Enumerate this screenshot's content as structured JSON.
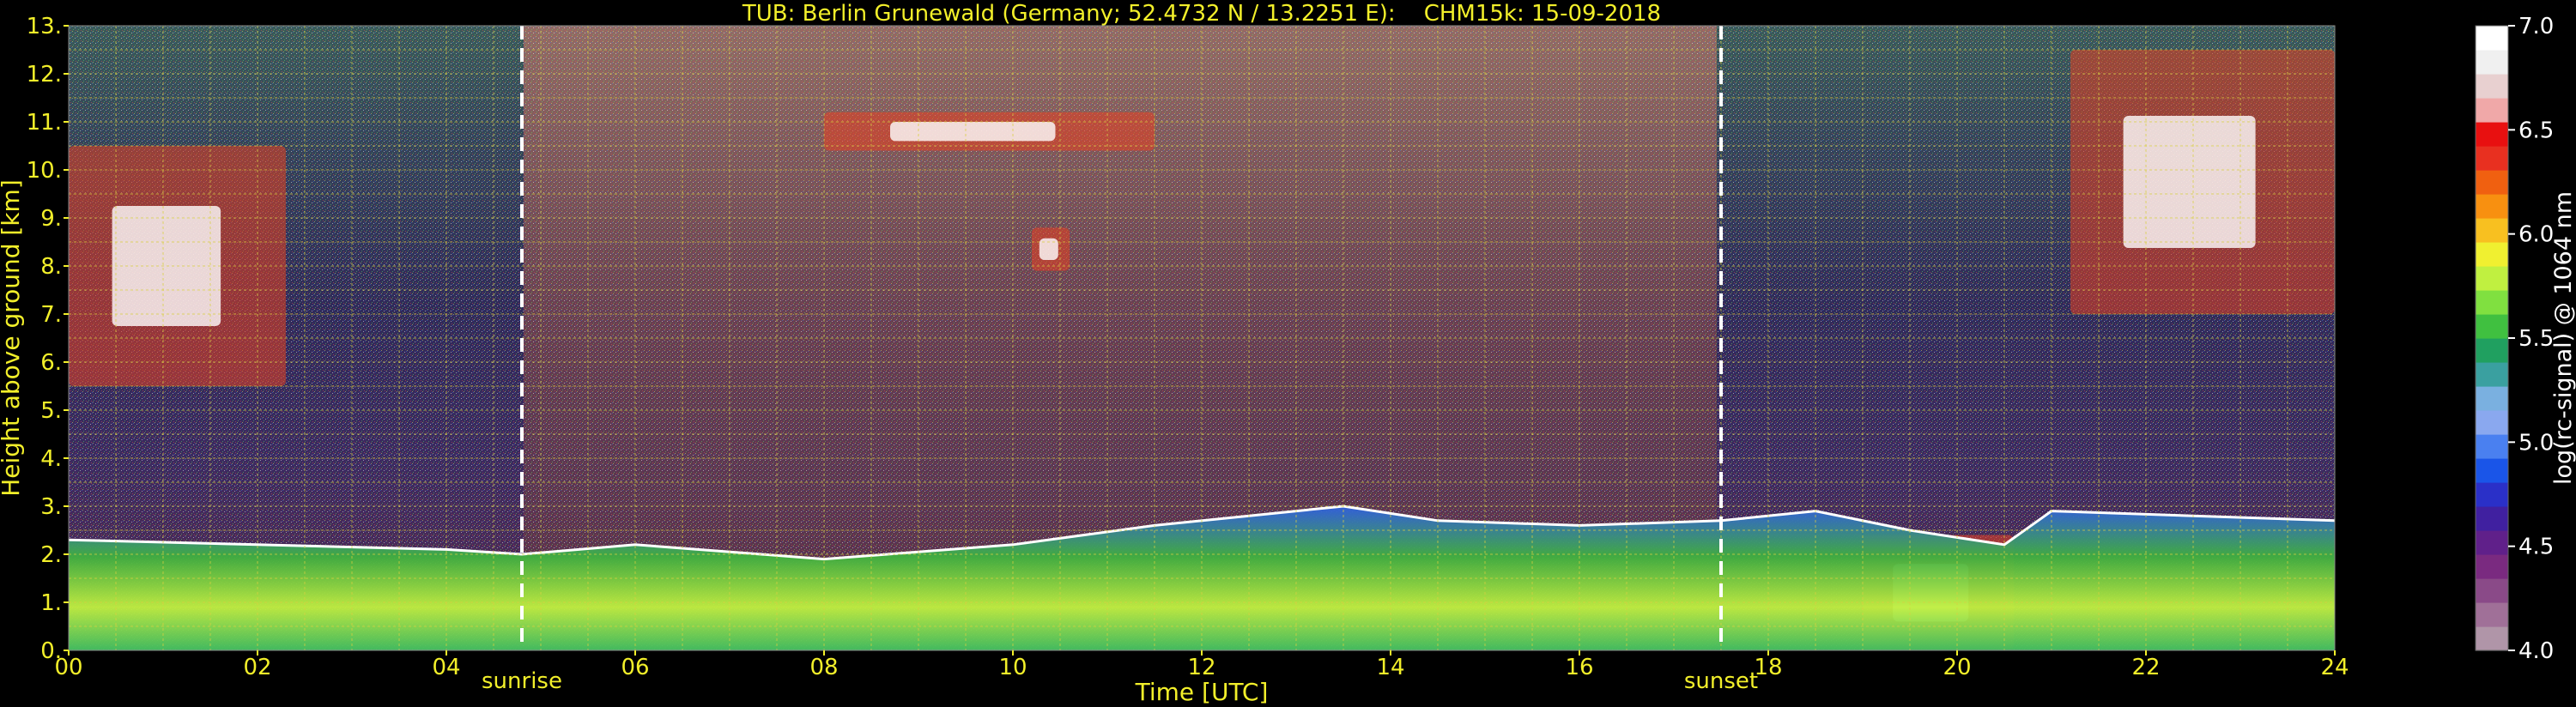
{
  "chart_data": {
    "type": "heatmap",
    "title": "TUB: Berlin Grunewald (Germany; 52.4732 N / 13.2251 E):    CHM15k: 15-09-2018",
    "xlabel": "Time [UTC]",
    "ylabel": "Height above ground [km]",
    "xlim": [
      0,
      24
    ],
    "ylim": [
      0,
      13
    ],
    "x_ticks": [
      "00",
      "02",
      "04",
      "06",
      "08",
      "10",
      "12",
      "14",
      "16",
      "18",
      "20",
      "22",
      "24"
    ],
    "y_ticks": [
      "0.",
      "1.",
      "2.",
      "3.",
      "4.",
      "5.",
      "6.",
      "7.",
      "8.",
      "9.",
      "10.",
      "11.",
      "12.",
      "13."
    ],
    "grid": true,
    "colorbar": {
      "label": "log(rc-signal) @ 1064 nm",
      "range": [
        4.0,
        7.0
      ],
      "ticks": [
        "4.0",
        "4.5",
        "5.0",
        "5.5",
        "6.0",
        "6.5",
        "7.0"
      ],
      "colors": [
        "#b095a8",
        "#a07098",
        "#8a4a88",
        "#7a2a80",
        "#60208a",
        "#4020a0",
        "#2a30c8",
        "#1a55e8",
        "#4a80f0",
        "#8aa8ef",
        "#7ab0e0",
        "#3aa0a0",
        "#20a060",
        "#40c040",
        "#80e040",
        "#c0f040",
        "#f0f030",
        "#f8c020",
        "#f89010",
        "#f06010",
        "#e83020",
        "#e81010",
        "#f0a8a8",
        "#e8d0d0",
        "#f0f0f0",
        "#ffffff"
      ]
    },
    "vlines": [
      {
        "x": 4.8,
        "label": "sunrise"
      },
      {
        "x": 17.5,
        "label": "sunset"
      }
    ],
    "boundary_layer_top_km": [
      [
        0,
        2.3
      ],
      [
        2,
        2.2
      ],
      [
        4,
        2.1
      ],
      [
        4.8,
        2.0
      ],
      [
        6,
        2.2
      ],
      [
        8,
        1.9
      ],
      [
        10,
        2.2
      ],
      [
        11.5,
        2.6
      ],
      [
        12.5,
        2.8
      ],
      [
        13.5,
        3.0
      ],
      [
        14.5,
        2.7
      ],
      [
        16,
        2.6
      ],
      [
        17.5,
        2.7
      ],
      [
        18.5,
        2.9
      ],
      [
        19.5,
        2.5
      ],
      [
        20.5,
        2.2
      ],
      [
        21,
        2.9
      ],
      [
        24,
        2.7
      ]
    ],
    "cloud_layers": [
      {
        "x_start": 0.0,
        "x_end": 2.3,
        "base_km": 5.5,
        "top_km": 10.5
      },
      {
        "x_start": 8.0,
        "x_end": 11.5,
        "base_km": 10.4,
        "top_km": 11.2
      },
      {
        "x_start": 10.2,
        "x_end": 10.6,
        "base_km": 7.9,
        "top_km": 8.8
      },
      {
        "x_start": 21.2,
        "x_end": 24.0,
        "base_km": 7.0,
        "top_km": 12.5
      },
      {
        "x_start": 19.0,
        "x_end": 20.6,
        "base_km": 0.0,
        "top_km": 2.4
      }
    ]
  }
}
